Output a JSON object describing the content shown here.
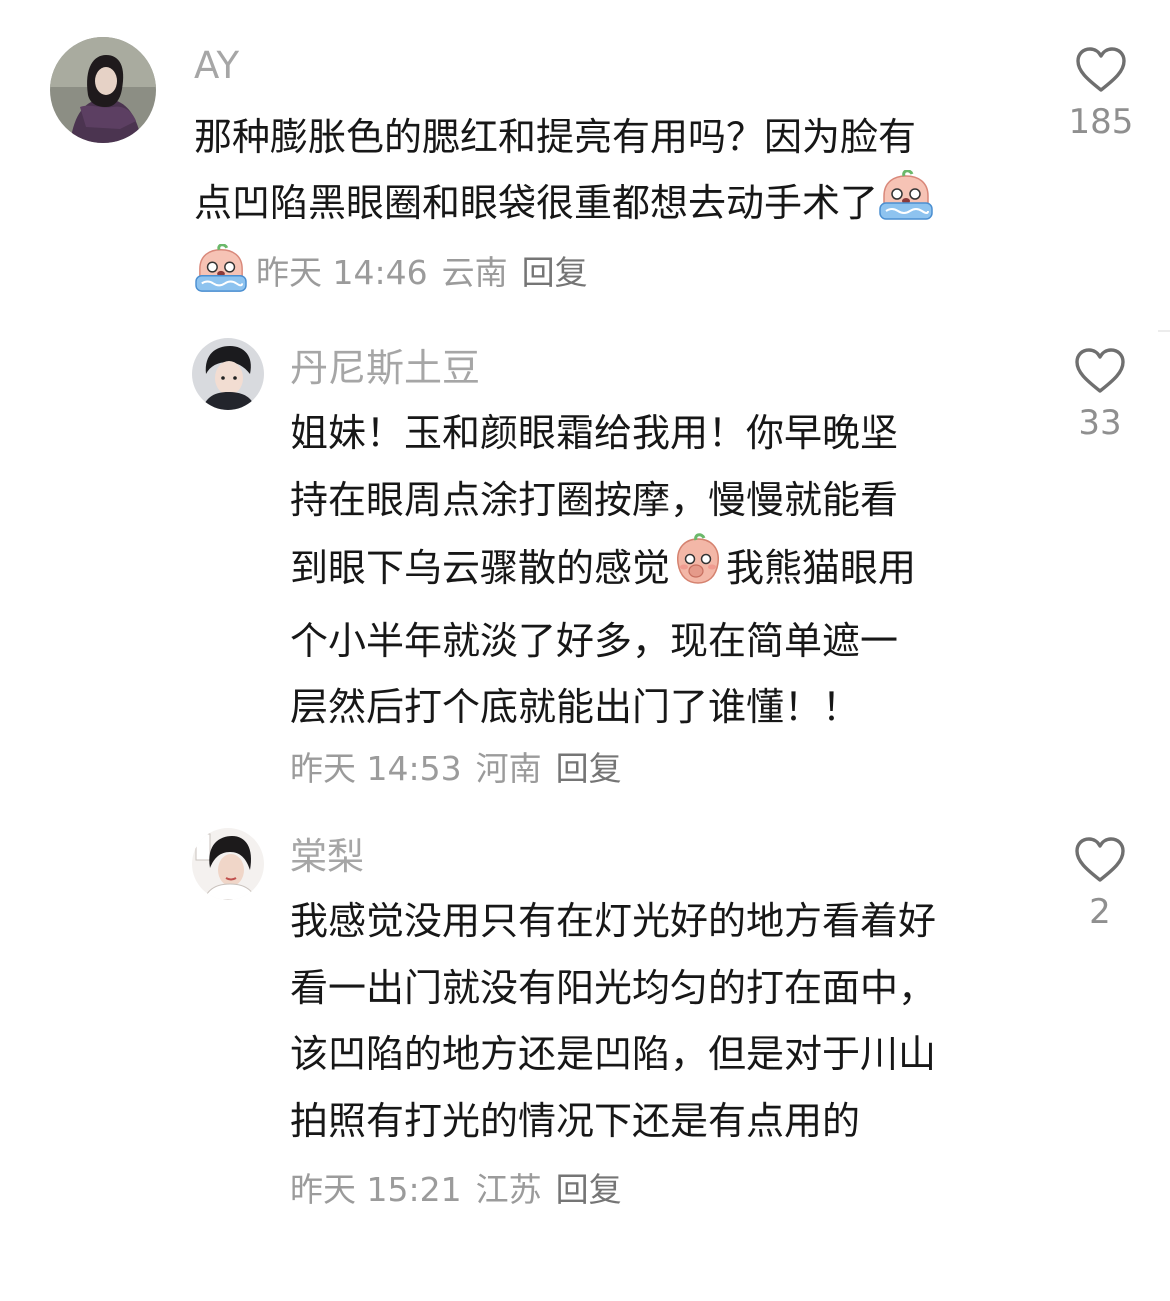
{
  "comments": [
    {
      "username": "AY",
      "lines": [
        "那种膨胀色的腮红和提亮有用吗？因为脸有",
        "点凹陷黑眼圈和眼袋很重都想去动手术了"
      ],
      "time": "昨天 14:46",
      "location": "云南",
      "reply_label": "回复",
      "likes": "185",
      "emoji_end": "crying-face-emoji",
      "emoji_meta": "crying-face-emoji"
    },
    {
      "username": "丹尼斯土豆",
      "lines": [
        "姐妹！玉和颜眼霜给我用！你早晚坚",
        "持在眼周点涂打圈按摩，慢慢就能看",
        "到眼下乌云骤散的感觉",
        "我熊猫眼用",
        "个小半年就淡了好多，现在简单遮一",
        "层然后打个底就能出门了谁懂！！"
      ],
      "time": "昨天 14:53",
      "location": "河南",
      "reply_label": "回复",
      "likes": "33",
      "emoji_inline": "shy-face-emoji"
    },
    {
      "username": "棠梨",
      "lines": [
        "我感觉没用只有在灯光好的地方看着好",
        "看一出门就没有阳光均匀的打在面中，",
        "该凹陷的地方还是凹陷，但是对于川山",
        "拍照有打光的情况下还是有点用的"
      ],
      "time": "昨天 15:21",
      "location": "江苏",
      "reply_label": "回复",
      "likes": "2"
    }
  ],
  "icons": {
    "like": "heart-outline-icon"
  },
  "colors": {
    "username": "#a6a6a6",
    "text": "#171717",
    "meta": "#9b9b9b",
    "icon": "#6f6f6f"
  }
}
